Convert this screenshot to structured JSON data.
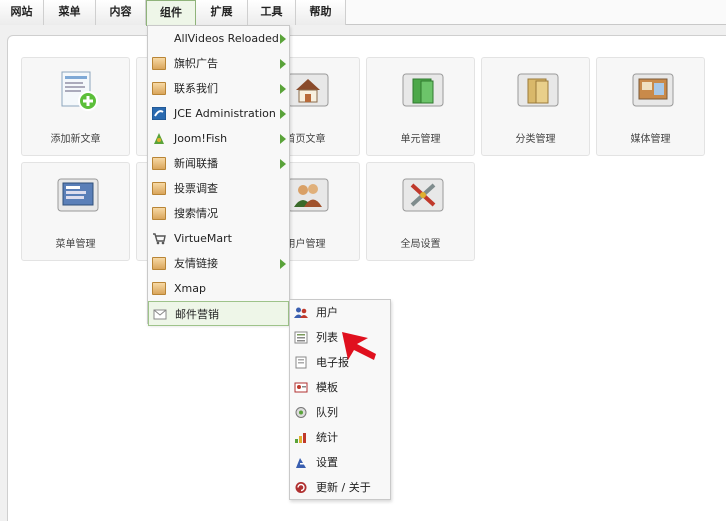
{
  "topmenu": [
    {
      "label": "网站"
    },
    {
      "label": "菜单"
    },
    {
      "label": "内容"
    },
    {
      "label": "组件"
    },
    {
      "label": "扩展"
    },
    {
      "label": "工具"
    },
    {
      "label": "帮助"
    }
  ],
  "tiles": [
    {
      "label": "添加新文章",
      "icon": "add-article-icon"
    },
    {
      "label": "首页文章",
      "icon": "home-icon"
    },
    {
      "label": "单元管理",
      "icon": "section-icon"
    },
    {
      "label": "分类管理",
      "icon": "category-icon"
    },
    {
      "label": "媒体管理",
      "icon": "media-icon"
    },
    {
      "label": "菜单管理",
      "icon": "menu-manager-icon"
    },
    {
      "label": "用户管理",
      "icon": "users-icon"
    },
    {
      "label": "全局设置",
      "icon": "config-icon"
    }
  ],
  "components_menu": [
    {
      "label": "AllVideos Reloaded",
      "icon": "",
      "submenu": true
    },
    {
      "label": "旗帜广告",
      "icon": "folder-icon",
      "submenu": true
    },
    {
      "label": "联系我们",
      "icon": "folder-icon",
      "submenu": true
    },
    {
      "label": "JCE Administration",
      "icon": "jce-icon",
      "submenu": true
    },
    {
      "label": "Joom!Fish",
      "icon": "joomfish-icon",
      "submenu": true
    },
    {
      "label": "新闻联播",
      "icon": "folder-icon",
      "submenu": true
    },
    {
      "label": "投票调查",
      "icon": "folder-icon",
      "submenu": false
    },
    {
      "label": "搜索情况",
      "icon": "folder-icon",
      "submenu": false
    },
    {
      "label": "VirtueMart",
      "icon": "cart-icon",
      "submenu": false
    },
    {
      "label": "友情链接",
      "icon": "folder-icon",
      "submenu": true
    },
    {
      "label": "Xmap",
      "icon": "folder-icon",
      "submenu": false
    },
    {
      "label": "邮件营销",
      "icon": "mail-icon",
      "submenu": false
    }
  ],
  "mail_submenu": [
    {
      "label": "用户",
      "icon": "users-icon"
    },
    {
      "label": "列表",
      "icon": "list-icon"
    },
    {
      "label": "电子报",
      "icon": "newsletter-icon"
    },
    {
      "label": "模板",
      "icon": "template-icon"
    },
    {
      "label": "队列",
      "icon": "queue-icon"
    },
    {
      "label": "统计",
      "icon": "stats-icon"
    },
    {
      "label": "设置",
      "icon": "settings-icon"
    },
    {
      "label": "更新 / 关于",
      "icon": "update-icon"
    }
  ],
  "colors": {
    "accent": "#5aa33a",
    "cursor": "#e0101e",
    "highlight_bg": "#eef6e8"
  }
}
